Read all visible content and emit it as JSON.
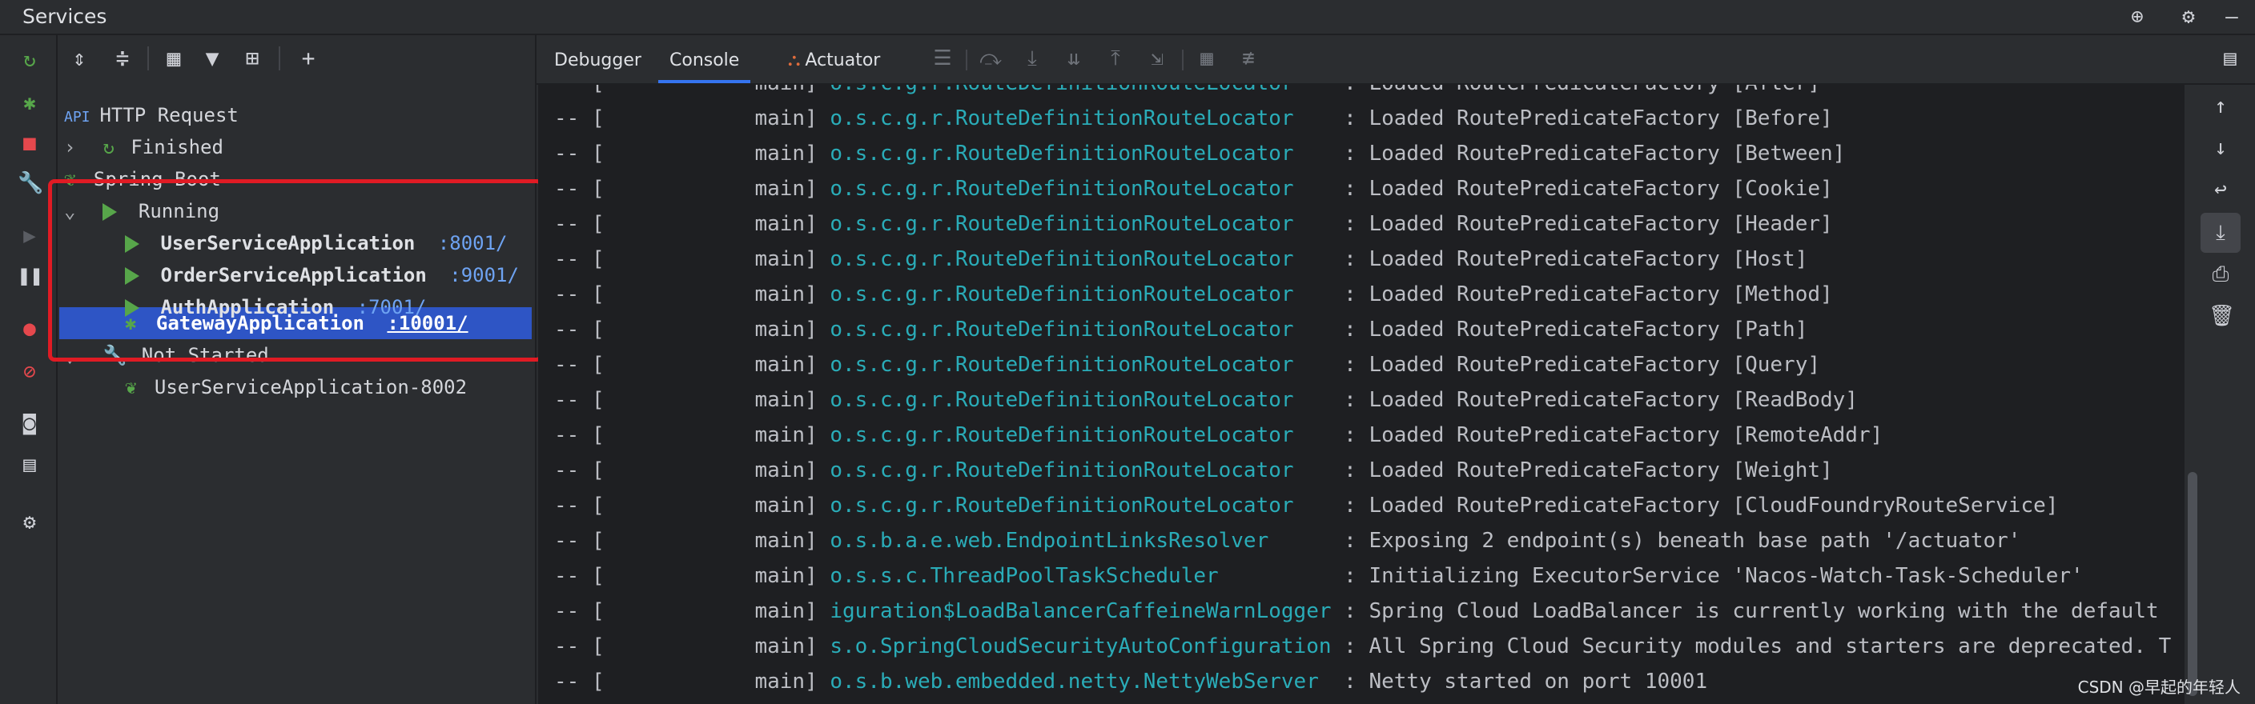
{
  "window": {
    "title": "Services"
  },
  "tree_nodes": [
    {
      "label": "HTTP Request"
    },
    {
      "label": "Finished"
    },
    {
      "label": "Spring Boot"
    },
    {
      "label": "Running"
    },
    {
      "label": "UserServiceApplication",
      "port": ":8001/"
    },
    {
      "label": "OrderServiceApplication",
      "port": ":9001/"
    },
    {
      "label": "AuthApplication",
      "port": ":7001/"
    },
    {
      "label": "GatewayApplication",
      "port": ":10001/"
    },
    {
      "label": "Not Started"
    },
    {
      "label": "UserServiceApplication-8002"
    }
  ],
  "tabs": [
    "Debugger",
    "Console",
    "Actuator"
  ],
  "console_lines": [
    {
      "prefix": "-- [            main] ",
      "logger": "o.s.c.g.r.RouteDefinitionRouteLocator   ",
      "message": " : Loaded RoutePredicateFactory [After]"
    },
    {
      "prefix": "-- [            main] ",
      "logger": "o.s.c.g.r.RouteDefinitionRouteLocator   ",
      "message": " : Loaded RoutePredicateFactory [Before]"
    },
    {
      "prefix": "-- [            main] ",
      "logger": "o.s.c.g.r.RouteDefinitionRouteLocator   ",
      "message": " : Loaded RoutePredicateFactory [Between]"
    },
    {
      "prefix": "-- [            main] ",
      "logger": "o.s.c.g.r.RouteDefinitionRouteLocator   ",
      "message": " : Loaded RoutePredicateFactory [Cookie]"
    },
    {
      "prefix": "-- [            main] ",
      "logger": "o.s.c.g.r.RouteDefinitionRouteLocator   ",
      "message": " : Loaded RoutePredicateFactory [Header]"
    },
    {
      "prefix": "-- [            main] ",
      "logger": "o.s.c.g.r.RouteDefinitionRouteLocator   ",
      "message": " : Loaded RoutePredicateFactory [Host]"
    },
    {
      "prefix": "-- [            main] ",
      "logger": "o.s.c.g.r.RouteDefinitionRouteLocator   ",
      "message": " : Loaded RoutePredicateFactory [Method]"
    },
    {
      "prefix": "-- [            main] ",
      "logger": "o.s.c.g.r.RouteDefinitionRouteLocator   ",
      "message": " : Loaded RoutePredicateFactory [Path]"
    },
    {
      "prefix": "-- [            main] ",
      "logger": "o.s.c.g.r.RouteDefinitionRouteLocator   ",
      "message": " : Loaded RoutePredicateFactory [Query]"
    },
    {
      "prefix": "-- [            main] ",
      "logger": "o.s.c.g.r.RouteDefinitionRouteLocator   ",
      "message": " : Loaded RoutePredicateFactory [ReadBody]"
    },
    {
      "prefix": "-- [            main] ",
      "logger": "o.s.c.g.r.RouteDefinitionRouteLocator   ",
      "message": " : Loaded RoutePredicateFactory [RemoteAddr]"
    },
    {
      "prefix": "-- [            main] ",
      "logger": "o.s.c.g.r.RouteDefinitionRouteLocator   ",
      "message": " : Loaded RoutePredicateFactory [Weight]"
    },
    {
      "prefix": "-- [            main] ",
      "logger": "o.s.c.g.r.RouteDefinitionRouteLocator   ",
      "message": " : Loaded RoutePredicateFactory [CloudFoundryRouteService]"
    },
    {
      "prefix": "-- [            main] ",
      "logger": "o.s.b.a.e.web.EndpointLinksResolver     ",
      "message": " : Exposing 2 endpoint(s) beneath base path '/actuator'"
    },
    {
      "prefix": "-- [            main] ",
      "logger": "o.s.s.c.ThreadPoolTaskScheduler         ",
      "message": " : Initializing ExecutorService 'Nacos-Watch-Task-Scheduler'"
    },
    {
      "prefix": "-- [            main] ",
      "logger": "iguration$LoadBalancerCaffeineWarnLogger",
      "message": " : Spring Cloud LoadBalancer is currently working with the default"
    },
    {
      "prefix": "-- [            main] ",
      "logger": "s.o.SpringCloudSecurityAutoConfiguration",
      "message": " : All Spring Cloud Security modules and starters are deprecated. T"
    },
    {
      "prefix": "-- [            main] ",
      "logger": "o.s.b.web.embedded.netty.NettyWebServer ",
      "message": " : Netty started on port 10001"
    }
  ],
  "watermark": "CSDN @早起的年轻人",
  "colors": {
    "accent": "#3574f0",
    "selection": "#2e55c5",
    "highlight_box": "#e01b24",
    "run_green": "#57a64a",
    "logger_teal": "#2aacb8",
    "port_blue": "#6ea3f2"
  },
  "icons": {
    "title_bar": [
      "crosshair-icon",
      "gear-icon",
      "minimize-icon"
    ],
    "left_strip": [
      "rerun-icon",
      "debug-icon",
      "stop-icon",
      "wrench-icon",
      "resume-icon",
      "pause-icon",
      "breakpoint-icon",
      "mute-breakpoints-icon",
      "camera-icon",
      "layout-icon",
      "settings-icon"
    ],
    "tree_toolbar": [
      "expand-all-icon",
      "collapse-all-icon",
      "group-icon",
      "filter-icon",
      "new-tab-icon",
      "add-icon"
    ],
    "right_tools": [
      "scroll-up-icon",
      "scroll-down-icon",
      "soft-wrap-icon",
      "scroll-to-end-icon",
      "print-icon",
      "trash-icon"
    ]
  }
}
